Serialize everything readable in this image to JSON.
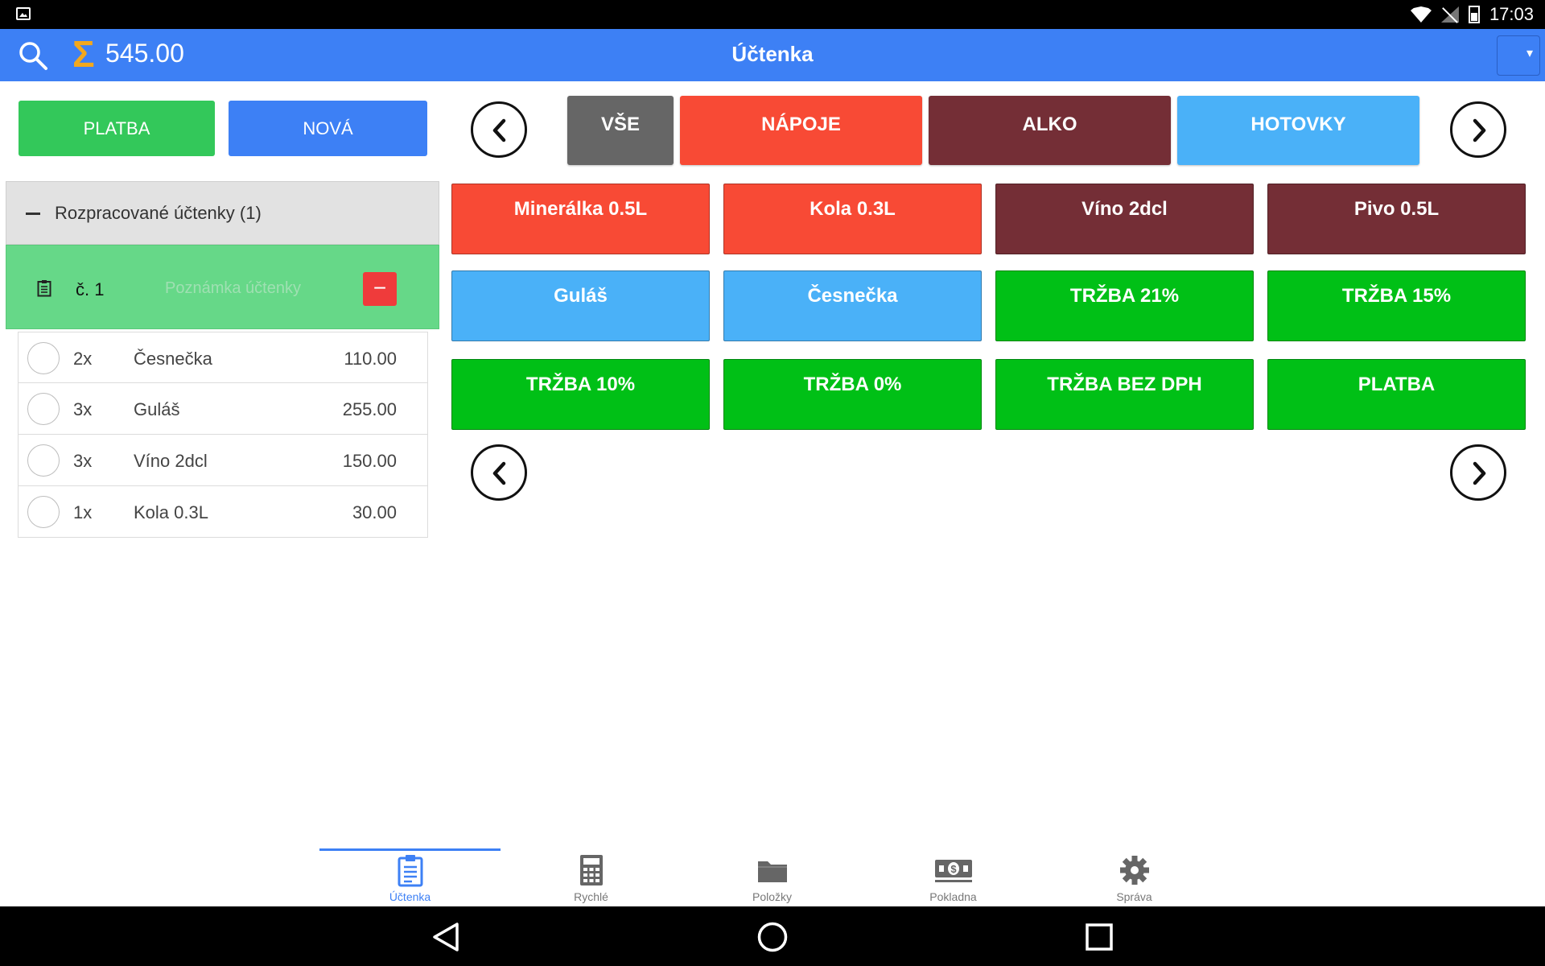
{
  "status_bar": {
    "time": "17:03"
  },
  "app_bar": {
    "total": "545.00",
    "title": "Účtenka"
  },
  "actions": {
    "pay_label": "PLATBA",
    "new_label": "NOVÁ"
  },
  "receipts_group": {
    "label": "Rozpracované účtenky (1)",
    "receipt": {
      "number": "č. 1",
      "note_placeholder": "Poznámka účtenky",
      "delete_label": "−"
    }
  },
  "items": [
    {
      "qty": "2x",
      "name": "Česnečka",
      "price": "110.00"
    },
    {
      "qty": "3x",
      "name": "Guláš",
      "price": "255.00"
    },
    {
      "qty": "3x",
      "name": "Víno 2dcl",
      "price": "150.00"
    },
    {
      "qty": "1x",
      "name": "Kola 0.3L",
      "price": "30.00"
    }
  ],
  "categories": [
    {
      "label": "VŠE",
      "color": "#666666"
    },
    {
      "label": "NÁPOJE",
      "color": "#f84a35"
    },
    {
      "label": "ALKO",
      "color": "#742e36"
    },
    {
      "label": "HOTOVKY",
      "color": "#4ab1f8"
    }
  ],
  "products": [
    {
      "label": "Minerálka 0.5L",
      "color": "#f84a35"
    },
    {
      "label": "Kola 0.3L",
      "color": "#f84a35"
    },
    {
      "label": "Víno 2dcl",
      "color": "#742e36"
    },
    {
      "label": "Pivo 0.5L",
      "color": "#742e36"
    },
    {
      "label": "Guláš",
      "color": "#4ab1f8"
    },
    {
      "label": "Česnečka",
      "color": "#4ab1f8"
    },
    {
      "label": "TRŽBA 21%",
      "color": "#00c016"
    },
    {
      "label": "TRŽBA 15%",
      "color": "#00c016"
    },
    {
      "label": "TRŽBA 10%",
      "color": "#00c016"
    },
    {
      "label": "TRŽBA 0%",
      "color": "#00c016"
    },
    {
      "label": "TRŽBA BEZ DPH",
      "color": "#00c016"
    },
    {
      "label": "PLATBA",
      "color": "#00c016"
    }
  ],
  "bottom_nav": {
    "active_color": "#3d80f5",
    "tabs": [
      {
        "label": "Účtenka",
        "icon": "clipboard-icon",
        "active": true
      },
      {
        "label": "Rychlé",
        "icon": "calculator-icon",
        "active": false
      },
      {
        "label": "Položky",
        "icon": "folder-icon",
        "active": false
      },
      {
        "label": "Pokladna",
        "icon": "cash-icon",
        "active": false
      },
      {
        "label": "Správa",
        "icon": "gear-icon",
        "active": false
      }
    ]
  },
  "system_nav": [
    "back-icon",
    "home-icon",
    "recents-icon"
  ]
}
